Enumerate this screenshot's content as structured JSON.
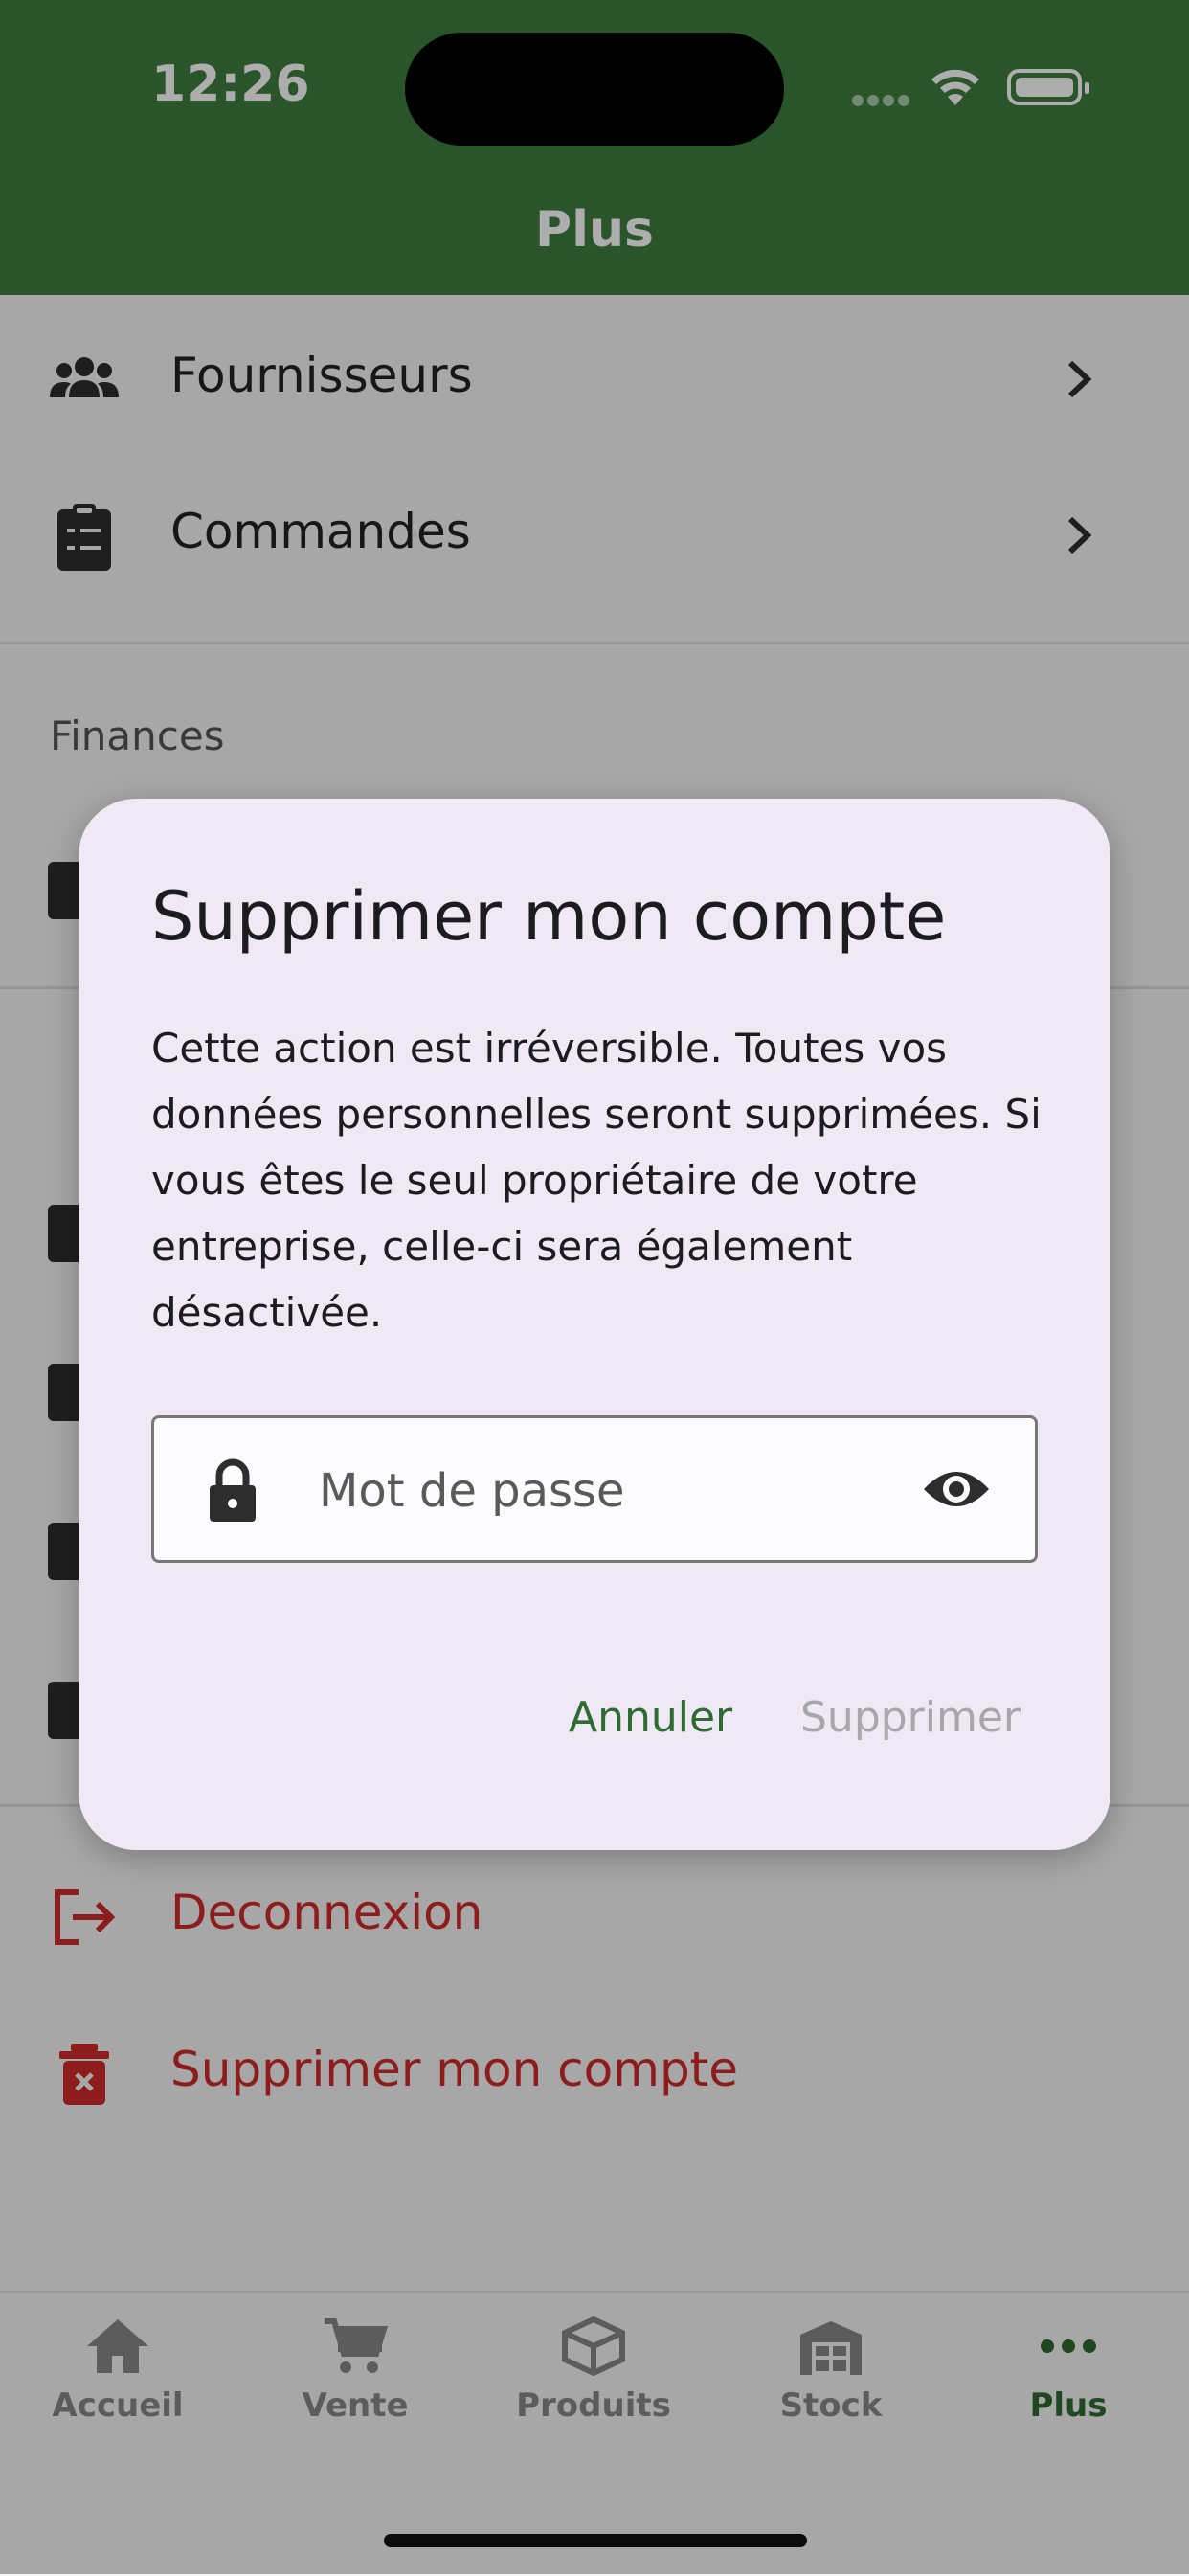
{
  "status_bar": {
    "time": "12:26"
  },
  "header": {
    "title": "Plus"
  },
  "menu": {
    "suppliers": "Fournisseurs",
    "orders": "Commandes",
    "finances_section": "Finances",
    "logout": "Deconnexion",
    "delete_account": "Supprimer mon compte"
  },
  "dialog": {
    "title": "Supprimer mon compte",
    "body": "Cette action est irréversible. Toutes vos données personnelles seront supprimées. Si vous êtes le seul propriétaire de votre entreprise, celle-ci sera également désactivée.",
    "password_placeholder": "Mot de passe",
    "cancel_label": "Annuler",
    "delete_label": "Supprimer"
  },
  "bottom_nav": {
    "items": [
      {
        "label": "Accueil",
        "icon": "home-icon"
      },
      {
        "label": "Vente",
        "icon": "cart-icon"
      },
      {
        "label": "Produits",
        "icon": "box-icon"
      },
      {
        "label": "Stock",
        "icon": "warehouse-icon"
      },
      {
        "label": "Plus",
        "icon": "more-icon",
        "active": true
      }
    ]
  },
  "colors": {
    "brand_green": "#3e7c3e",
    "danger_red": "#d02c2c",
    "dialog_bg": "#efe8f5"
  }
}
